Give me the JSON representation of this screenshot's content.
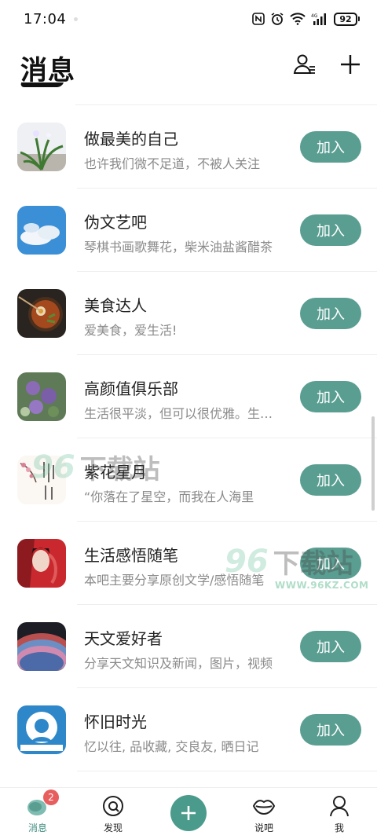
{
  "status_bar": {
    "time": "17:04",
    "battery": "92",
    "network": "4G"
  },
  "header": {
    "title": "消息"
  },
  "groups": [
    {
      "name": "做最美的自己",
      "desc": "也许我们微不足道，不被人关注",
      "action": "加入"
    },
    {
      "name": "伪文艺吧",
      "desc": "琴棋书画歌舞花，柴米油盐酱醋茶",
      "action": "加入"
    },
    {
      "name": "美食达人",
      "desc": "爱美食，爱生活!",
      "action": "加入"
    },
    {
      "name": "高颜值俱乐部",
      "desc": "生活很平淡，但可以很优雅。生活很平淡",
      "action": "加入"
    },
    {
      "name": "紫花星月",
      "desc": "“你落在了星空，而我在人海里",
      "action": "加入"
    },
    {
      "name": "生活感悟随笔",
      "desc": "本吧主要分享原创文学/感悟随笔",
      "action": "加入"
    },
    {
      "name": "天文爱好者",
      "desc": "分享天文知识及新闻，图片，视频",
      "action": "加入"
    },
    {
      "name": "怀旧时光",
      "desc": "忆以往, 品收藏, 交良友, 晒日记",
      "action": "加入"
    }
  ],
  "watermark": {
    "num": "96",
    "text": "下载站",
    "url": "WWW.96KZ.COM"
  },
  "bottom_nav": {
    "messages": {
      "label": "消息",
      "badge": "2"
    },
    "discover": {
      "label": "发现"
    },
    "talk": {
      "label": "说吧"
    },
    "me": {
      "label": "我"
    }
  },
  "colors": {
    "accent": "#5a9e92",
    "badge": "#e85e5e"
  }
}
